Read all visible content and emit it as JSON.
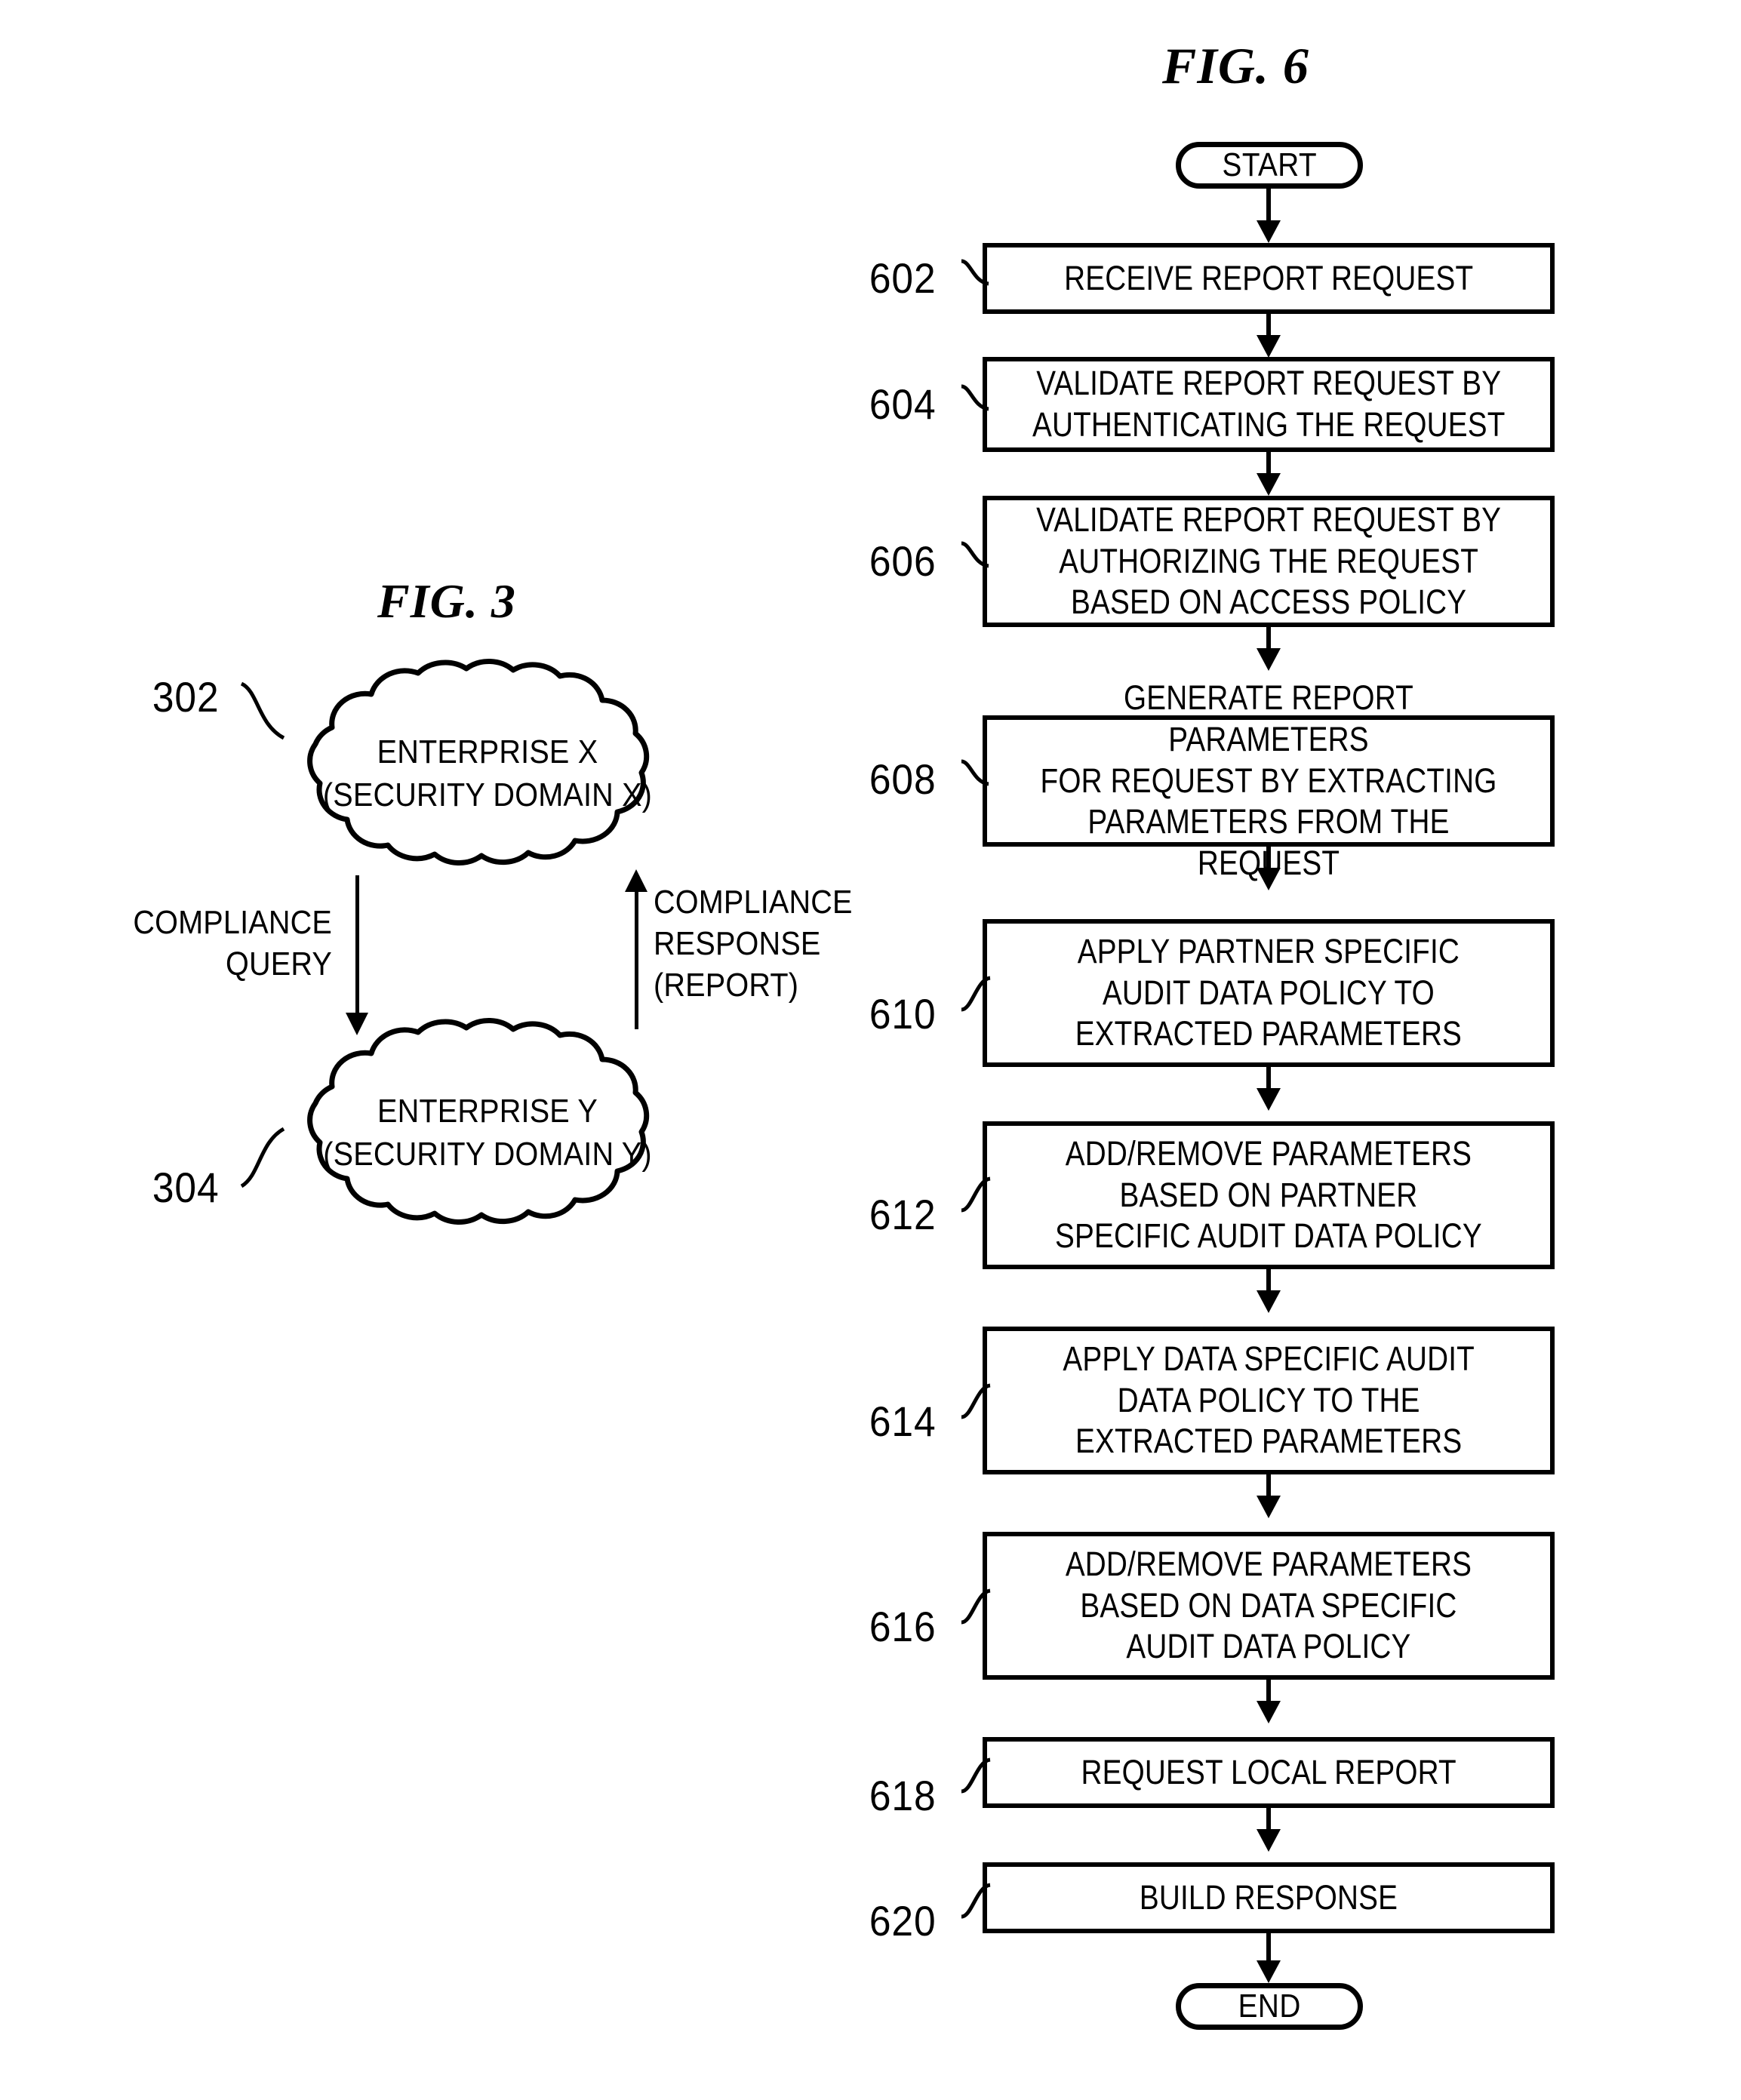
{
  "figures": {
    "fig6": {
      "title": "FIG. 6",
      "start_label": "START",
      "end_label": "END",
      "steps": [
        {
          "ref": "602",
          "text": "RECEIVE REPORT REQUEST"
        },
        {
          "ref": "604",
          "text": "VALIDATE REPORT REQUEST BY\nAUTHENTICATING THE REQUEST"
        },
        {
          "ref": "606",
          "text": "VALIDATE REPORT REQUEST BY\nAUTHORIZING THE REQUEST\nBASED ON ACCESS POLICY"
        },
        {
          "ref": "608",
          "text": "GENERATE REPORT PARAMETERS\nFOR REQUEST BY EXTRACTING\nPARAMETERS FROM THE REQUEST"
        },
        {
          "ref": "610",
          "text": "APPLY PARTNER SPECIFIC\nAUDIT DATA POLICY TO\nEXTRACTED PARAMETERS"
        },
        {
          "ref": "612",
          "text": "ADD/REMOVE PARAMETERS\nBASED ON PARTNER\nSPECIFIC AUDIT DATA POLICY"
        },
        {
          "ref": "614",
          "text": "APPLY DATA SPECIFIC AUDIT\nDATA POLICY TO THE\nEXTRACTED PARAMETERS"
        },
        {
          "ref": "616",
          "text": "ADD/REMOVE PARAMETERS\nBASED ON DATA SPECIFIC\nAUDIT DATA POLICY"
        },
        {
          "ref": "618",
          "text": "REQUEST LOCAL REPORT"
        },
        {
          "ref": "620",
          "text": "BUILD RESPONSE"
        }
      ]
    },
    "fig3": {
      "title": "FIG. 3",
      "clouds": [
        {
          "ref": "302",
          "text": "ENTERPRISE X\n(SECURITY DOMAIN X)"
        },
        {
          "ref": "304",
          "text": "ENTERPRISE Y\n(SECURITY DOMAIN Y)"
        }
      ],
      "flows": [
        {
          "name": "compliance-query",
          "text": "COMPLIANCE\nQUERY",
          "direction": "down"
        },
        {
          "name": "compliance-response",
          "text": "COMPLIANCE\nRESPONSE\n(REPORT)",
          "direction": "up"
        }
      ]
    }
  },
  "colors": {
    "ink": "#000000",
    "paper": "#ffffff"
  }
}
